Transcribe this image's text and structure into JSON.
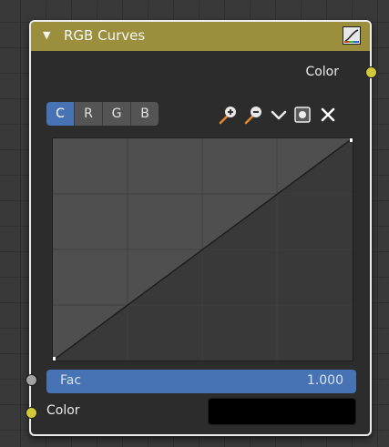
{
  "node": {
    "title": "RGB Curves",
    "output_label": "Color",
    "channels": [
      "C",
      "R",
      "G",
      "B"
    ],
    "active_channel": "C",
    "tools": [
      "zoom-in-icon",
      "zoom-out-icon",
      "chevron-down-icon",
      "clipping-icon",
      "reset-icon"
    ],
    "fac_label": "Fac",
    "fac_value": "1.000",
    "fac_fraction": 1.0,
    "color_label": "Color",
    "color_value": "#000000",
    "header_color": "#9b8f3d",
    "accent_color": "#4772b3",
    "socket_color_yellow": "#d2c93a",
    "socket_color_gray": "#a1a1a1"
  }
}
